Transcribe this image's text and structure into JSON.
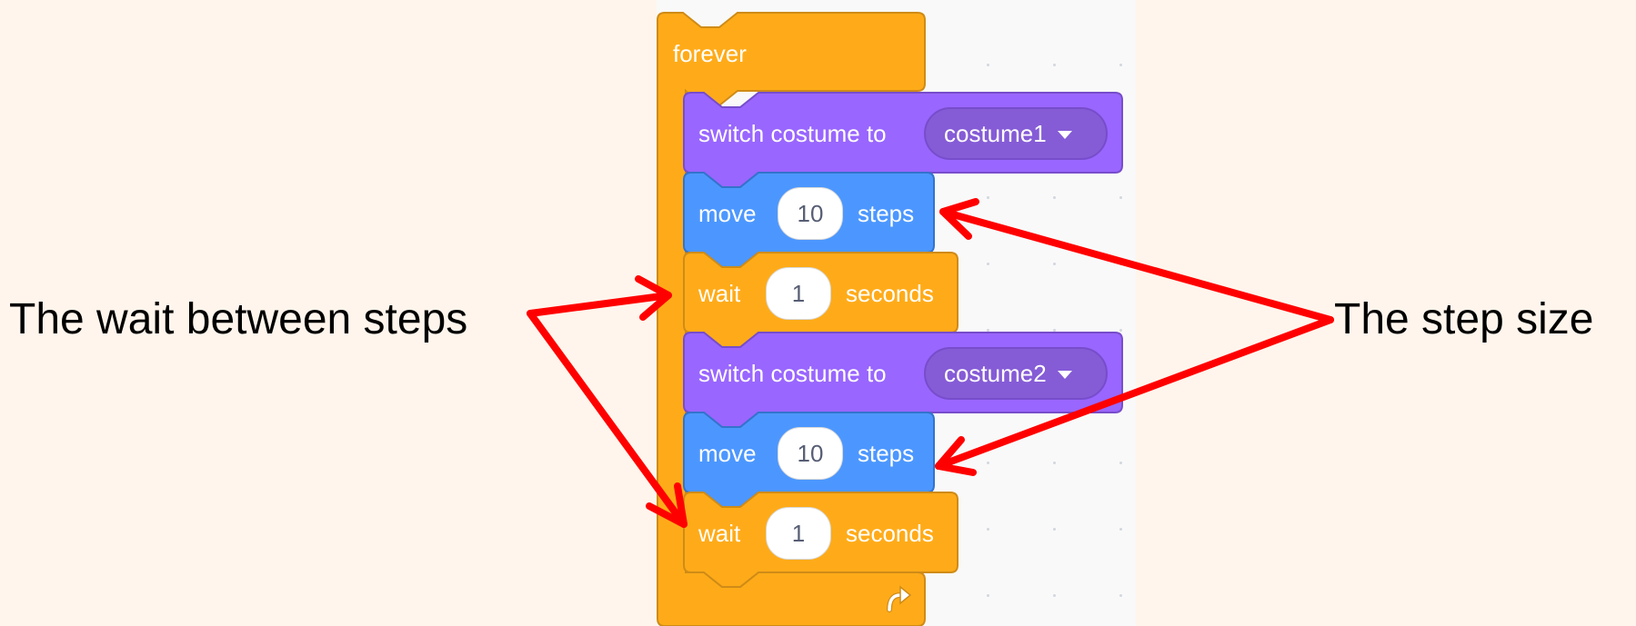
{
  "script": {
    "forever_label": "forever",
    "blocks": [
      {
        "type": "looks",
        "label": "switch costume to",
        "value": "costume1"
      },
      {
        "type": "motion",
        "label": "move",
        "value": "10",
        "suffix": "steps"
      },
      {
        "type": "control",
        "label": "wait",
        "value": "1",
        "suffix": "seconds"
      },
      {
        "type": "looks",
        "label": "switch costume to",
        "value": "costume2"
      },
      {
        "type": "motion",
        "label": "move",
        "value": "10",
        "suffix": "steps"
      },
      {
        "type": "control",
        "label": "wait",
        "value": "1",
        "suffix": "seconds"
      }
    ],
    "loop_icon": "loop-arrow-icon"
  },
  "annotations": {
    "left": "The wait between steps",
    "right": "The step size"
  },
  "colors": {
    "control": "#ffab19",
    "control_border": "#cf8b17",
    "looks": "#9966ff",
    "looks_border": "#774dcb",
    "motion": "#4c97ff",
    "motion_border": "#3373cc",
    "arrow": "#ff0000",
    "background": "#fff5ec"
  }
}
